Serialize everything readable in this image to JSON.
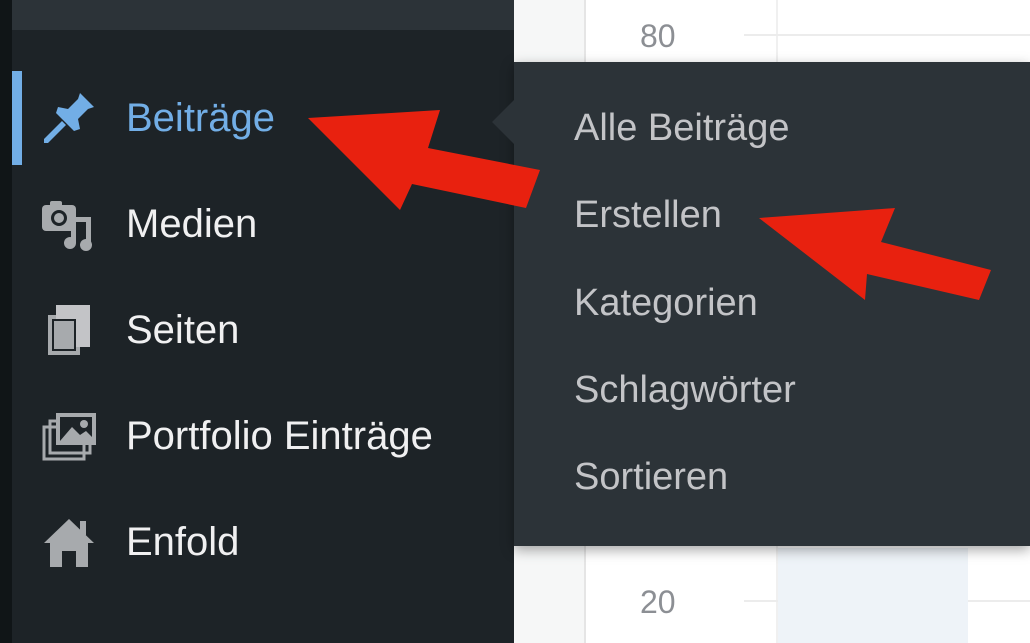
{
  "sidebar": {
    "items": [
      {
        "label": "Beiträge",
        "icon": "pin-icon",
        "active": true
      },
      {
        "label": "Medien",
        "icon": "media-icon",
        "active": false
      },
      {
        "label": "Seiten",
        "icon": "pages-icon",
        "active": false
      },
      {
        "label": "Portfolio Einträge",
        "icon": "portfolio-icon",
        "active": false
      },
      {
        "label": "Enfold",
        "icon": "home-icon",
        "active": false
      }
    ]
  },
  "submenu": {
    "items": [
      {
        "label": "Alle Beiträge"
      },
      {
        "label": "Erstellen"
      },
      {
        "label": "Kategorien"
      },
      {
        "label": "Schlagwörter"
      },
      {
        "label": "Sortieren"
      }
    ]
  },
  "chart": {
    "axis_labels": [
      "80",
      "20"
    ]
  },
  "colors": {
    "sidebar_bg": "#1d2327",
    "submenu_bg": "#2c3338",
    "active_accent": "#72aee6",
    "annotation_arrow": "#e8210f"
  }
}
